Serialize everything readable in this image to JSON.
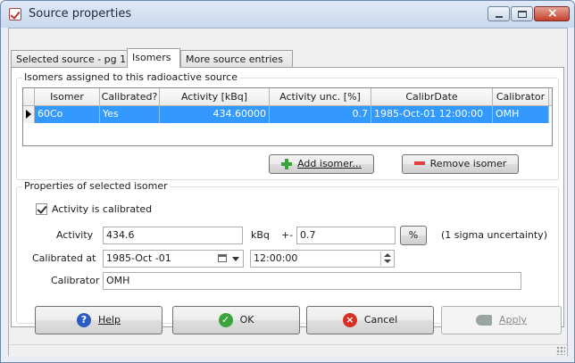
{
  "window": {
    "title": "Source properties"
  },
  "tabs": [
    {
      "label": "Selected source - pg 1"
    },
    {
      "label": "Isomers"
    },
    {
      "label": "More source entries"
    }
  ],
  "isomers_group": {
    "label": "Isomers assigned to this radioactive source",
    "columns": [
      "Isomer",
      "Calibrated?",
      "Activity [kBq]",
      "Activity unc. [%]",
      "CalibrDate",
      "Calibrator"
    ],
    "rows": [
      {
        "isomer": "60Co",
        "calibrated": "Yes",
        "activity": "434.60000",
        "activity_unc": "0.7",
        "calibr_date": "1985-Oct-01 12:00:00",
        "calibrator": "OMH"
      }
    ],
    "add_button": "Add isomer...",
    "remove_button": "Remove isomer"
  },
  "properties_group": {
    "label": "Properties of selected isomer",
    "activity_calibrated_label": "Activity is calibrated",
    "activity_label": "Activity",
    "activity_value": "434.6",
    "activity_unit": "kBq",
    "plusminus": "+-",
    "uncertainty_value": "0.7",
    "percent_button": "%",
    "sigma_note": "(1 sigma uncertainty)",
    "calibrated_at_label": "Calibrated at",
    "calibrated_date": "1985-Oct -01",
    "calibrated_time": "12:00:00",
    "calibrator_label": "Calibrator",
    "calibrator_value": "OMH"
  },
  "buttons": {
    "help": "Help",
    "ok": "OK",
    "cancel": "Cancel",
    "apply": "Apply"
  },
  "colors": {
    "selection": "#3399ff",
    "title_gradient_top": "#dfe9f6"
  }
}
